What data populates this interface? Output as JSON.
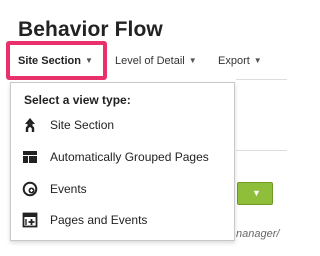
{
  "page": {
    "title": "Behavior Flow"
  },
  "tabs": [
    {
      "label": "Site Section"
    },
    {
      "label": "Level of Detail"
    },
    {
      "label": "Export"
    }
  ],
  "dropdown": {
    "heading": "Select a view type:",
    "items": [
      {
        "label": "Site Section",
        "icon": "branch-icon"
      },
      {
        "label": "Automatically Grouped Pages",
        "icon": "grouped-pages-icon"
      },
      {
        "label": "Events",
        "icon": "events-icon"
      },
      {
        "label": "Pages and Events",
        "icon": "pages-events-icon"
      }
    ]
  },
  "background": {
    "partial_text": "nanager/"
  },
  "colors": {
    "highlight": "#e8306a",
    "green": "#8fbf3a"
  }
}
